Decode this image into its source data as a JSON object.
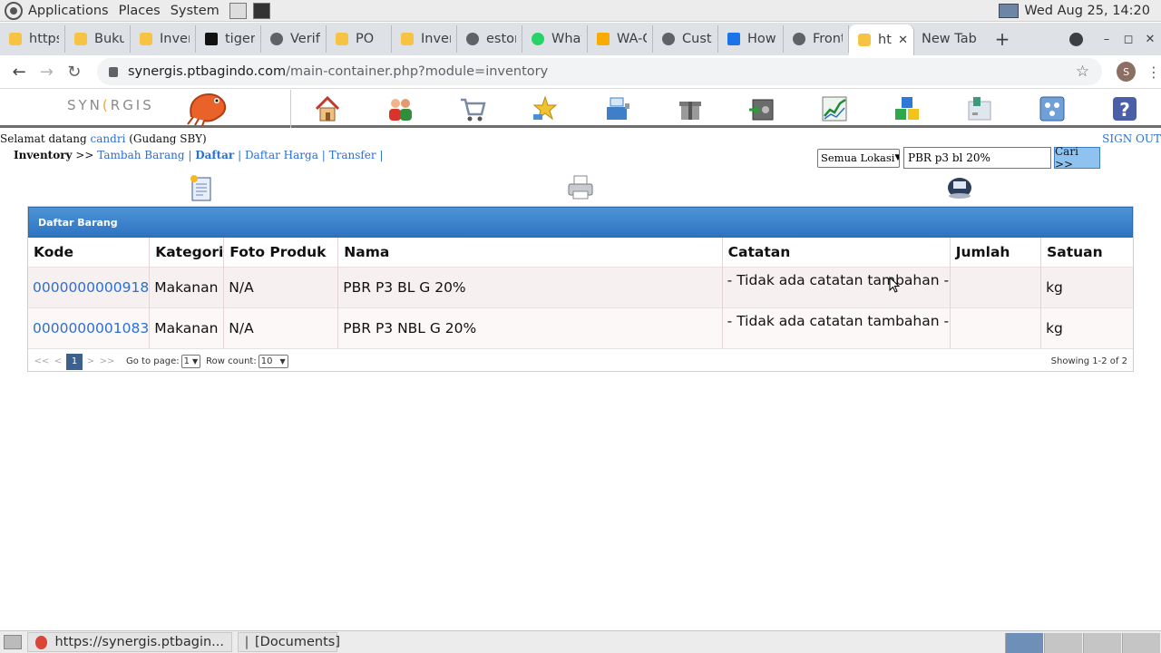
{
  "os_panel": {
    "menus": [
      "Applications",
      "Places",
      "System"
    ],
    "clock": "Wed Aug 25, 14:20"
  },
  "browser": {
    "tabs": [
      {
        "title": "https",
        "icon": "page-icon"
      },
      {
        "title": "Buku",
        "icon": "page-icon"
      },
      {
        "title": "Inver",
        "icon": "page-icon"
      },
      {
        "title": "tiger",
        "icon": "vnc-icon"
      },
      {
        "title": "Verifi",
        "icon": "globe-icon"
      },
      {
        "title": "PO",
        "icon": "page-icon"
      },
      {
        "title": "Inver",
        "icon": "page-icon"
      },
      {
        "title": "estor",
        "icon": "globe-icon"
      },
      {
        "title": "What",
        "icon": "whatsapp-icon"
      },
      {
        "title": "WA-C",
        "icon": "doc-icon"
      },
      {
        "title": "Custo",
        "icon": "globe-icon"
      },
      {
        "title": "How",
        "icon": "blue-icon"
      },
      {
        "title": "Front",
        "icon": "globe-icon"
      },
      {
        "title": "ht",
        "icon": "page-icon",
        "active": true
      },
      {
        "title": "New Tab",
        "icon": ""
      }
    ],
    "url_host": "synergis.ptbagindo.com",
    "url_path": "/main-container.php?module=inventory",
    "profile_initial": "S"
  },
  "app": {
    "logo_text_pre": "SYN",
    "logo_text_c": "(",
    "logo_text_post": "RGIS",
    "welcome_prefix": "Selamat datang",
    "user": "candri",
    "location": "(Gudang SBY)",
    "signout": "SIGN OUT",
    "crumb_module": "Inventory",
    "crumb_arrow": ">>",
    "crumb_links": [
      "Tambah Barang",
      "Daftar",
      "Daftar Harga",
      "Transfer"
    ],
    "location_select": "Semua Lokasi",
    "search_value": "PBR p3 bl 20%",
    "search_button": "Cari >>"
  },
  "grid": {
    "title": "Daftar Barang",
    "columns": [
      "Kode",
      "Kategori",
      "Foto Produk",
      "Nama",
      "Catatan",
      "Jumlah",
      "Satuan"
    ],
    "rows": [
      {
        "kode": "0000000000918",
        "kategori": "Makanan",
        "foto": "N/A",
        "nama": "PBR P3 BL G 20%",
        "catatan": "- Tidak ada catatan tambahan -",
        "jumlah": "",
        "satuan": "kg"
      },
      {
        "kode": "0000000001083",
        "kategori": "Makanan",
        "foto": "N/A",
        "nama": "PBR P3 NBL G 20%",
        "catatan": "- Tidak ada catatan tambahan -",
        "jumlah": "",
        "satuan": "kg"
      }
    ],
    "pager": {
      "first": "<<",
      "prev": "<",
      "current": "1",
      "next": ">",
      "last": ">>",
      "goto_label": "Go to page:",
      "goto_value": "1",
      "rowcount_label": "Row count:",
      "rowcount_value": "10",
      "showing": "Showing 1-2 of 2"
    }
  },
  "taskbar": {
    "tasks": [
      "https://synergis.ptbagin...",
      "[Documents]"
    ]
  },
  "colors": {
    "link": "#2a6fd6",
    "grid_header": "#2e73c0",
    "search_button": "#8ec3f0"
  }
}
